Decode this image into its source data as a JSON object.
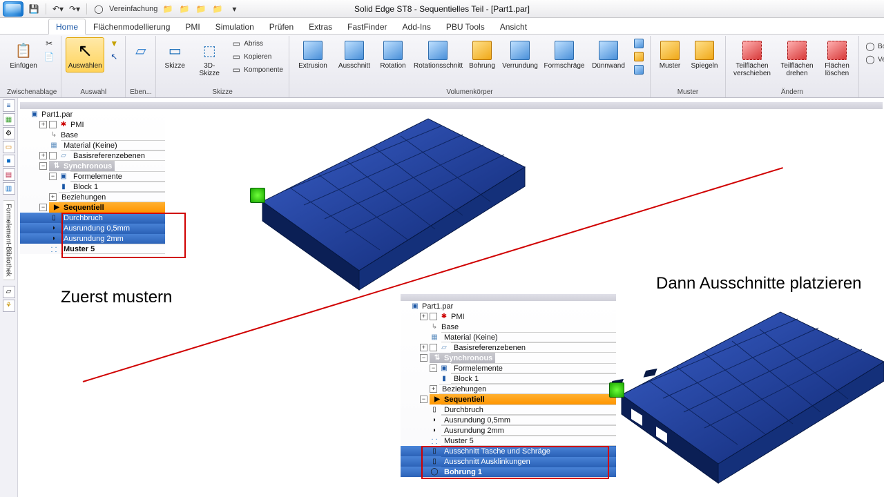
{
  "title": "Solid Edge ST8 - Sequentielles Teil - [Part1.par]",
  "qat": {
    "vereinfachung": "Vereinfachung"
  },
  "tabs": [
    "Home",
    "Flächenmodellierung",
    "PMI",
    "Simulation",
    "Prüfen",
    "Extras",
    "FastFinder",
    "Add-Ins",
    "PBU Tools",
    "Ansicht"
  ],
  "ribbon": {
    "groups": {
      "zwischenablage": {
        "label": "Zwischenablage",
        "einfuegen": "Einfügen"
      },
      "auswahl": {
        "label": "Auswahl",
        "auswaehlen": "Auswählen"
      },
      "eben": {
        "label": "Eben..."
      },
      "skizze": {
        "label": "Skizze",
        "skizze_btn": "Skizze",
        "skizze3d": "3D-Skizze",
        "abriss": "Abriss",
        "kopieren": "Kopieren",
        "komponente": "Komponente"
      },
      "volumen": {
        "label": "Volumenkörper",
        "extrusion": "Extrusion",
        "ausschnitt": "Ausschnitt",
        "rotation": "Rotation",
        "rotationsschnitt": "Rotationsschnitt",
        "bohrung": "Bohrung",
        "verrundung": "Verrundung",
        "formschraege": "Formschräge",
        "duennwand": "Dünnwand"
      },
      "muster": {
        "label": "Muster",
        "muster_btn": "Muster",
        "spiegeln": "Spiegeln"
      },
      "aendern": {
        "label": "Ändern",
        "teilflaechen_v": "Teilflächen verschieben",
        "teilflaechen_d": "Teilflächen drehen",
        "flaechen_l": "Flächen löschen"
      },
      "extra": {
        "bohrdurch": "Bohrdurchmesse",
        "verrundungs": "Verrundungsgröß"
      }
    }
  },
  "side_tab_label": "Formelement-Bibliothek",
  "tree": {
    "root": "Part1.par",
    "pmi": "PMI",
    "base": "Base",
    "material": "Material (Keine)",
    "basisref": "Basisreferenzebenen",
    "synchronous": "Synchronous",
    "formelemente": "Formelemente",
    "block1": "Block 1",
    "beziehungen": "Beziehungen",
    "sequentiell": "Sequentiell",
    "items_a": [
      "Durchbruch",
      "Ausrundung 0,5mm",
      "Ausrundung 2mm",
      "Muster 5"
    ],
    "items_b_extra": [
      "Ausschnitt Tasche und Schräge",
      "Ausschnitt Ausklinkungen",
      "Bohrung 1"
    ]
  },
  "annotations": {
    "zuerst": "Zuerst mustern",
    "dann": "Dann Ausschnitte platzieren"
  }
}
